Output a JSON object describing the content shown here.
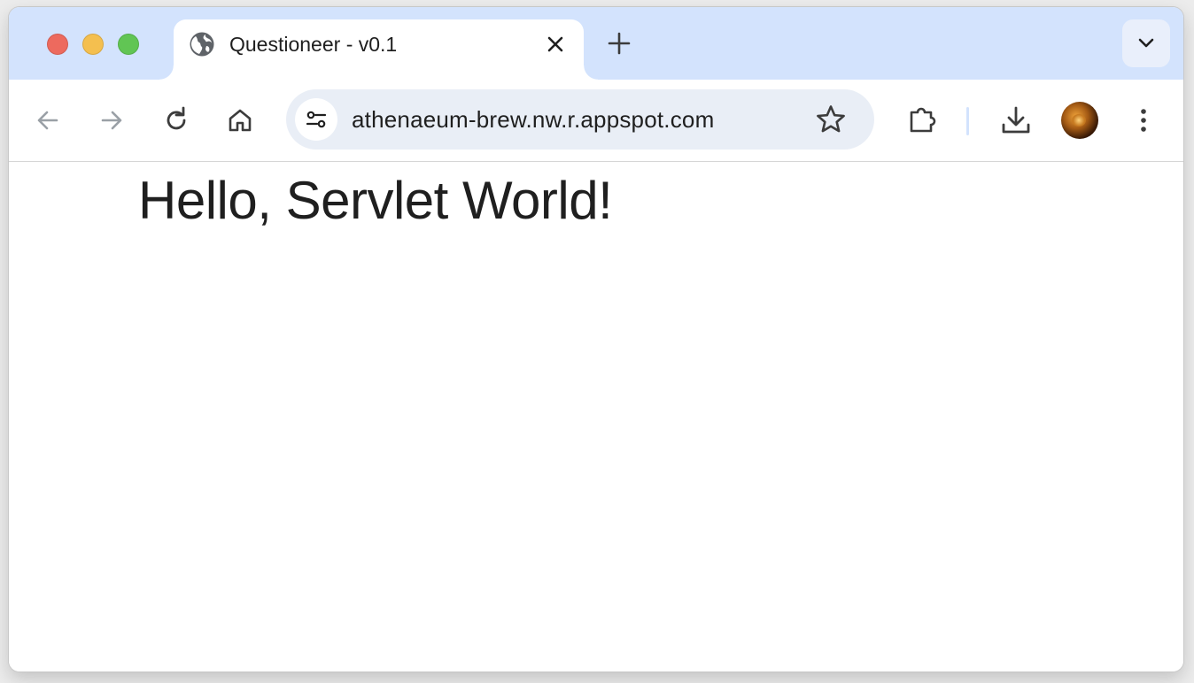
{
  "browser": {
    "tab": {
      "title": "Questioneer - v0.1",
      "favicon": "globe-icon"
    },
    "address_bar": {
      "url": "athenaeum-brew.nw.r.appspot.com"
    },
    "toolbar_icons": [
      "back-arrow-icon",
      "forward-arrow-icon",
      "reload-icon",
      "home-icon",
      "site-settings-icon",
      "bookmark-star-icon",
      "extensions-icon",
      "download-icon",
      "profile-avatar",
      "more-menu-icon"
    ],
    "colors": {
      "titlebar": "#d3e3fd",
      "omnibox": "#e9eef6",
      "close": "#ed6a5e",
      "minimize": "#f4bf4f",
      "maximize": "#61c554"
    }
  },
  "page": {
    "heading": "Hello, Servlet World!"
  }
}
